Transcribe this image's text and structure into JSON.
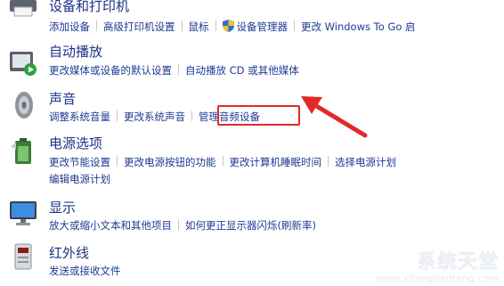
{
  "devices": {
    "title": "设备和打印机",
    "links": [
      "添加设备",
      "高级打印机设置",
      "鼠标",
      "设备管理器",
      "更改 Windows To Go 启"
    ]
  },
  "autoplay": {
    "title": "自动播放",
    "links": [
      "更改媒体或设备的默认设置",
      "自动播放 CD 或其他媒体"
    ]
  },
  "sound": {
    "title": "声音",
    "links": [
      "调整系统音量",
      "更改系统声音",
      "管理音频设备"
    ]
  },
  "power": {
    "title": "电源选项",
    "links": [
      "更改节能设置",
      "更改电源按钮的功能",
      "更改计算机睡眠时间",
      "选择电源计划"
    ],
    "links2": [
      "编辑电源计划"
    ]
  },
  "display": {
    "title": "显示",
    "links": [
      "放大或缩小文本和其他项目",
      "如何更正显示器闪烁(刷新率)"
    ]
  },
  "infrared": {
    "title": "红外线",
    "links": [
      "发送或接收文件"
    ]
  },
  "annotation": {
    "color": "#e02a2a"
  },
  "icons": {
    "devices": "printer-icon",
    "autoplay": "autoplay-icon",
    "sound": "speaker-icon",
    "power": "battery-icon",
    "display": "monitor-icon",
    "infrared": "infrared-icon",
    "device_manager": "uac-shield-icon"
  },
  "watermark": {
    "logo": "系统天堂",
    "url": "www.xitongtiantang.com"
  }
}
